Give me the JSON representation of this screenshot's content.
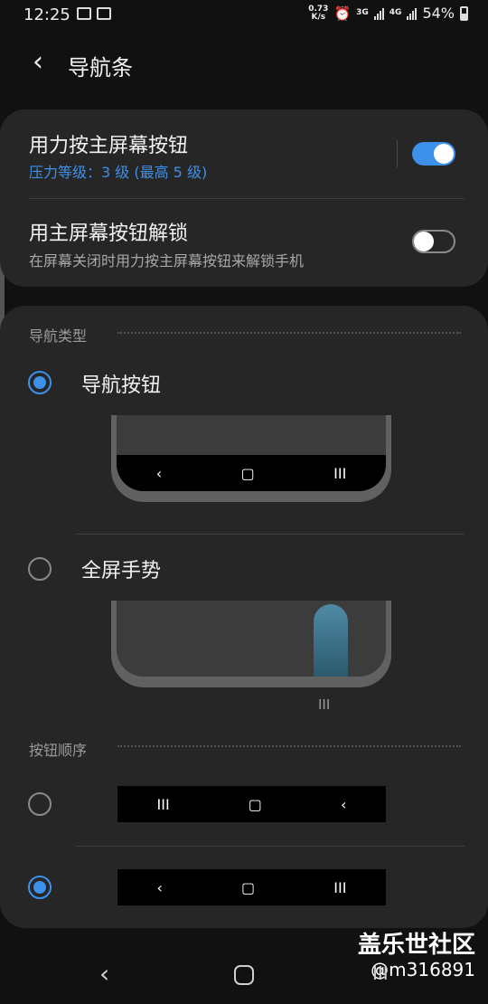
{
  "status_bar": {
    "time": "12:25",
    "net_speed_value": "0.73",
    "net_speed_unit": "K/s",
    "net1": "3G",
    "net2": "4G",
    "battery": "54%"
  },
  "header": {
    "title": "导航条"
  },
  "pressure_section": {
    "press_home": {
      "title": "用力按主屏幕按钮",
      "subtitle": "压力等级：3 级 (最高 5 级)",
      "enabled": true
    },
    "unlock": {
      "title": "用主屏幕按钮解锁",
      "subtitle": "在屏幕关闭时用力按主屏幕按钮来解锁手机",
      "enabled": false
    }
  },
  "nav_type": {
    "label": "导航类型",
    "options": [
      {
        "label": "导航按钮",
        "selected": true,
        "nav_keys": [
          "‹",
          "▢",
          "III"
        ]
      },
      {
        "label": "全屏手势",
        "selected": false,
        "hint": "III"
      }
    ]
  },
  "button_order": {
    "label": "按钮顺序",
    "options": [
      {
        "selected": false,
        "keys": [
          "III",
          "▢",
          "‹"
        ]
      },
      {
        "selected": true,
        "keys": [
          "‹",
          "▢",
          "III"
        ]
      }
    ]
  },
  "system_nav": {
    "back": "‹",
    "recent": "III"
  },
  "watermark": {
    "title": "盖乐世社区",
    "user": "@m316891"
  },
  "colors": {
    "accent": "#3e91ea",
    "card": "#262626",
    "background": "#111111"
  }
}
